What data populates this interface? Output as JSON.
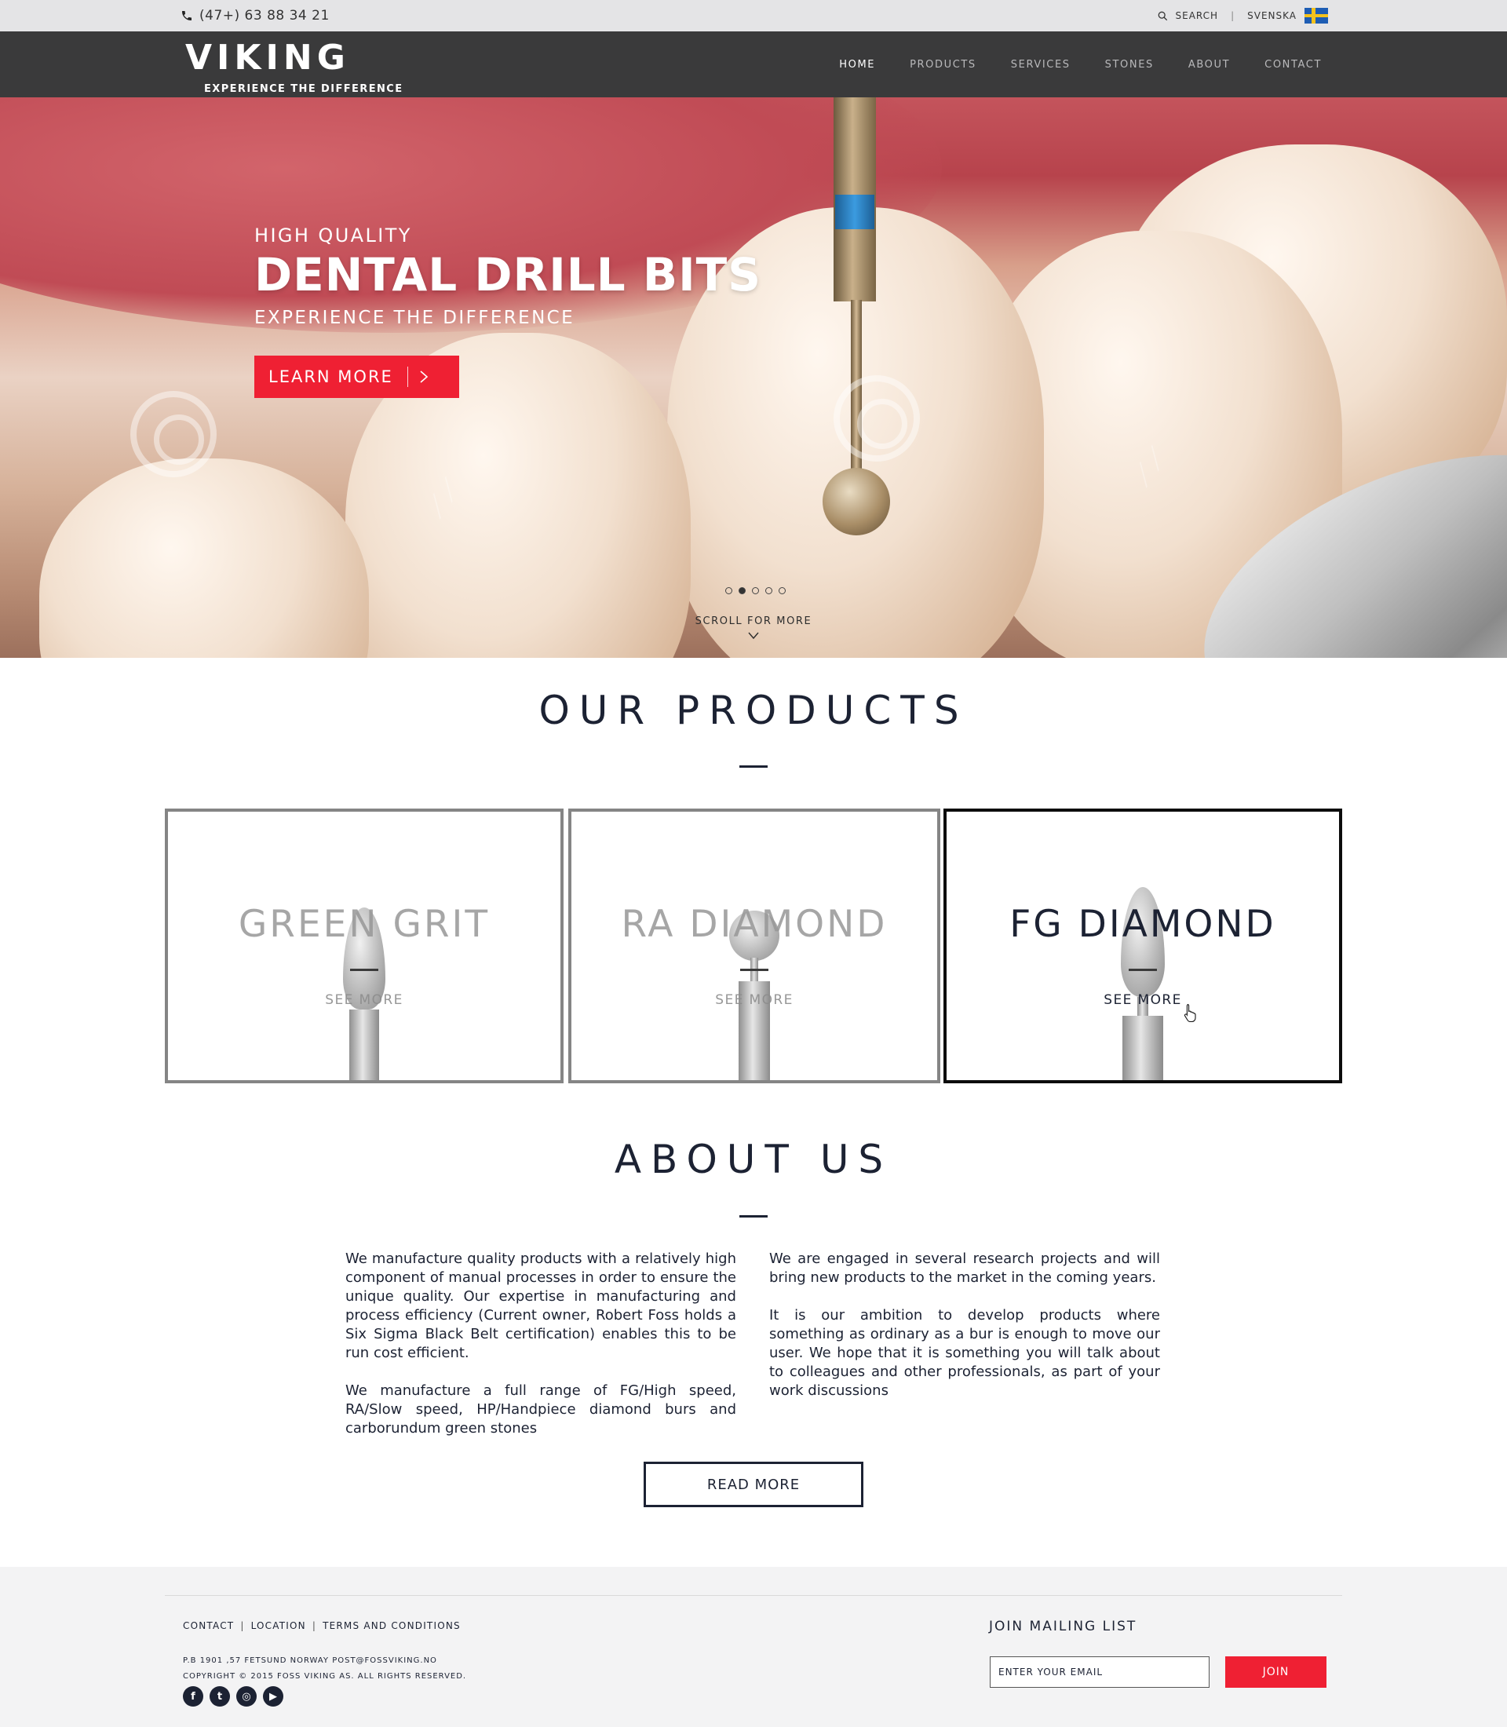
{
  "topbar": {
    "phone": "(47+) 63 88 34 21",
    "phone_icon": "phone-icon",
    "search_label": "SEARCH",
    "separator": "|",
    "language_label": "SVENSKA",
    "flag_icon": "sweden-flag-icon"
  },
  "nav": {
    "brand": "VIKING",
    "tagline": "EXPERIENCE THE DIFFERENCE",
    "items": [
      {
        "label": "HOME",
        "active": true
      },
      {
        "label": "PRODUCTS",
        "active": false
      },
      {
        "label": "SERVICES",
        "active": false
      },
      {
        "label": "STONES",
        "active": false
      },
      {
        "label": "ABOUT",
        "active": false
      },
      {
        "label": "CONTACT",
        "active": false
      }
    ]
  },
  "hero": {
    "eyebrow": "HIGH QUALITY",
    "title": "DENTAL DRILL BITS",
    "subtitle": "EXPERIENCE THE DIFFERENCE",
    "cta_label": "LEARN MORE",
    "slide_count": 5,
    "active_slide": 2,
    "scroll_label": "SCROLL FOR MORE"
  },
  "products": {
    "heading": "OUR PRODUCTS",
    "cards": [
      {
        "title": "GREEN GRIT",
        "link": "SEE MORE",
        "hovered": false
      },
      {
        "title": "RA DIAMOND",
        "link": "SEE MORE",
        "hovered": false
      },
      {
        "title": "FG DIAMOND",
        "link": "SEE MORE",
        "hovered": true
      }
    ]
  },
  "about": {
    "heading": "ABOUT US",
    "left_paragraphs": [
      "We manufacture quality products with a relatively high component of manual processes in order to ensure the unique quality. Our expertise in manufacturing and process efficiency (Current owner, Robert Foss holds a Six Sigma Black Belt certification) enables this to be run cost efficient.",
      "We manufacture a full range of FG/High speed, RA/Slow speed, HP/Handpiece diamond burs and carborundum green stones"
    ],
    "right_paragraphs": [
      "We are engaged in several research projects and will bring new products to the market in the coming years.",
      "It is our ambition to develop products where something as ordinary as a bur is enough to move our user. We hope that it is something you will talk about to colleagues and other professionals, as part of your work discussions"
    ],
    "read_more_label": "READ MORE"
  },
  "footer": {
    "links": [
      "CONTACT",
      "LOCATION",
      "TERMS AND CONDITIONS"
    ],
    "link_separator": "|",
    "address": "P.B 1901 ,57 FETSUND NORWAY  POST@FOSSVIKING.NO",
    "copyright": "COPYRIGHT © 2015 FOSS VIKING AS. ALL RIGHTS RESERVED.",
    "socials": [
      {
        "icon": "facebook-icon",
        "glyph": "f"
      },
      {
        "icon": "twitter-icon",
        "glyph": "t"
      },
      {
        "icon": "instagram-icon",
        "glyph": "◎"
      },
      {
        "icon": "youtube-icon",
        "glyph": "▶"
      }
    ],
    "mailing_title": "JOIN MAILING LIST",
    "email_placeholder": "ENTER YOUR EMAIL",
    "join_label": "JOIN"
  },
  "colors": {
    "accent_red": "#ef2033",
    "nav_bg": "#3a3a3b",
    "topbar_bg": "#e4e4e6",
    "ink": "#1c2233",
    "footer_bg": "#f3f3f4"
  }
}
